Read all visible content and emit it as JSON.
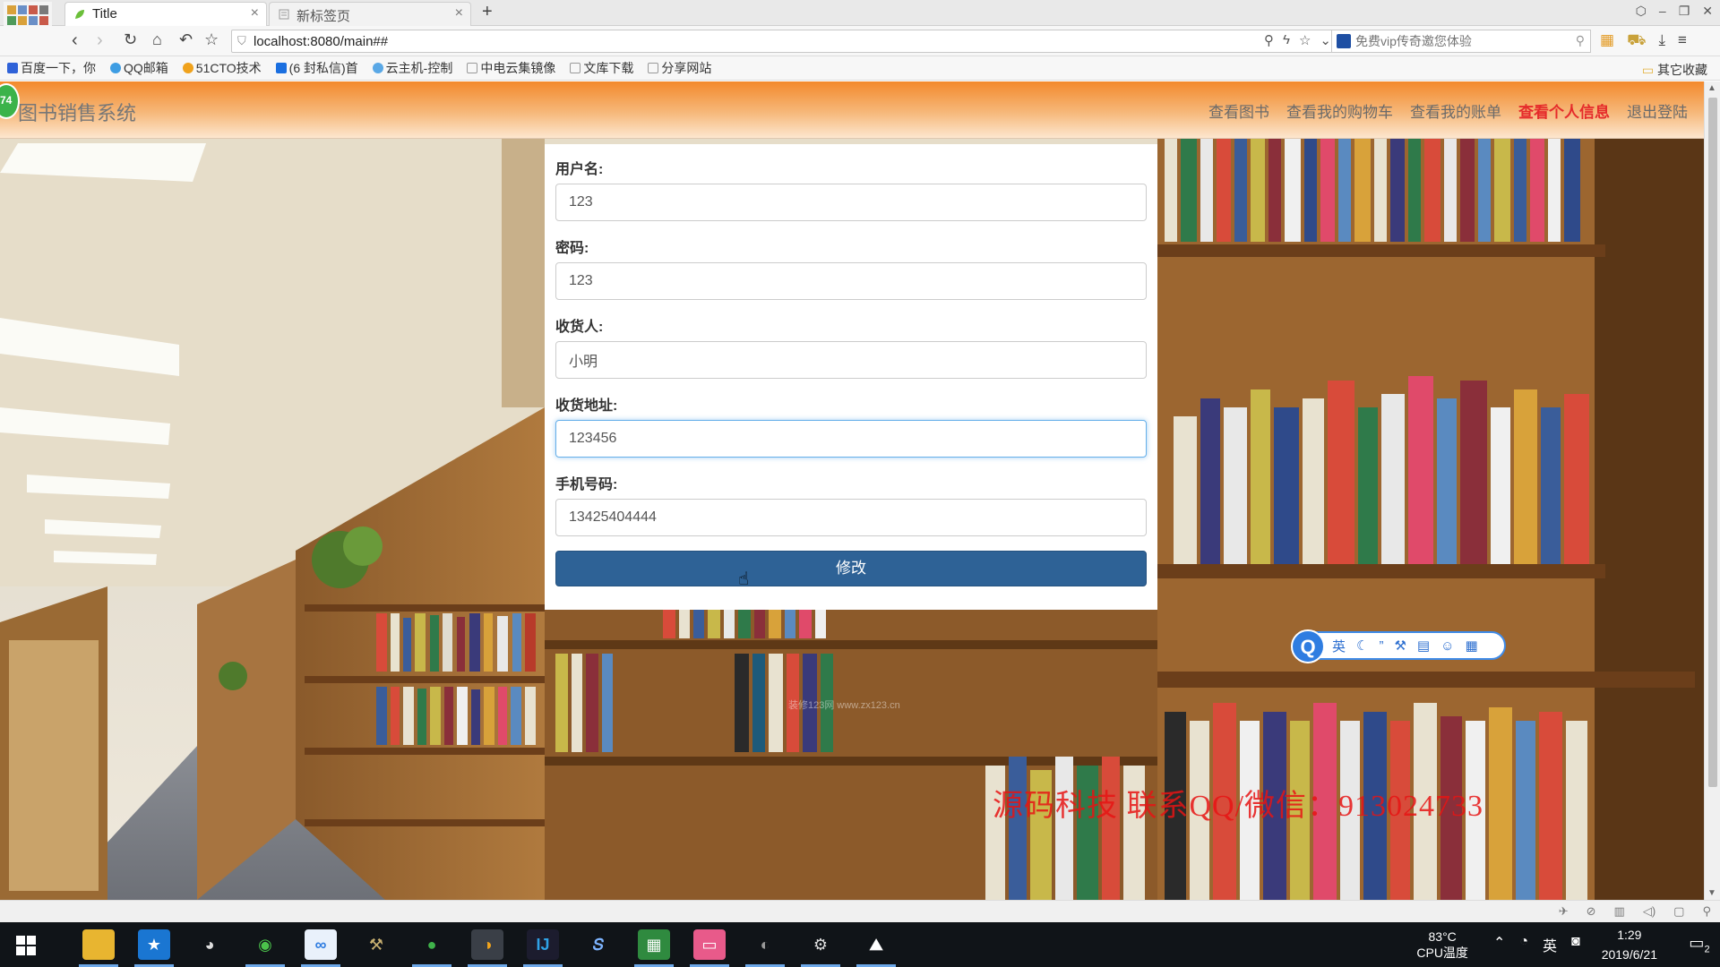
{
  "browser": {
    "tabs": [
      {
        "label": "Title",
        "active": true
      },
      {
        "label": "新标签页",
        "active": false
      }
    ],
    "new_tab_symbol": "+",
    "close_symbol": "×",
    "address": "localhost:8080/main##",
    "search_placeholder": "免费vip传奇邀您体验",
    "bookmarks": [
      {
        "label": "百度一下，你",
        "icon": "baidu-icon"
      },
      {
        "label": "QQ邮箱",
        "icon": "qqmail-icon"
      },
      {
        "label": "51CTO技术",
        "icon": "51cto-icon"
      },
      {
        "label": "(6 封私信)首",
        "icon": "zhihu-icon"
      },
      {
        "label": "云主机-控制",
        "icon": "cloud-icon"
      },
      {
        "label": "中电云集镜像",
        "icon": "page-icon"
      },
      {
        "label": "文库下载",
        "icon": "page-icon"
      },
      {
        "label": "分享网站",
        "icon": "page-icon"
      }
    ],
    "other_bookmarks": "其它收藏"
  },
  "site": {
    "brand": "图书销售系统",
    "badge": "74",
    "nav": [
      {
        "label": "查看图书",
        "active": false
      },
      {
        "label": "查看我的购物车",
        "active": false
      },
      {
        "label": "查看我的账单",
        "active": false
      },
      {
        "label": "查看个人信息",
        "active": true
      },
      {
        "label": "退出登陆",
        "active": false
      }
    ]
  },
  "form": {
    "fields": [
      {
        "label": "用户名:",
        "value": "123"
      },
      {
        "label": "密码:",
        "value": "123"
      },
      {
        "label": "收货人:",
        "value": "小明"
      },
      {
        "label": "收货地址:",
        "value": "123456"
      },
      {
        "label": "手机号码:",
        "value": "13425404444"
      }
    ],
    "submit_label": "修改"
  },
  "watermarks": {
    "small": "装修123网 www.zx123.cn",
    "red": "源码科技  联系QQ/微信：913024733"
  },
  "ime": {
    "logo": "Q",
    "mode": "英"
  },
  "taskbar": {
    "cpu_temp": "83°C",
    "cpu_label": "CPU温度",
    "ime_mode": "英",
    "time": "1:29",
    "date": "2019/6/21",
    "notifications": "2"
  },
  "colors": {
    "nav_active": "#e52b2b",
    "submit_button": "#2e6296",
    "navbar_orange": "#f3892c"
  }
}
